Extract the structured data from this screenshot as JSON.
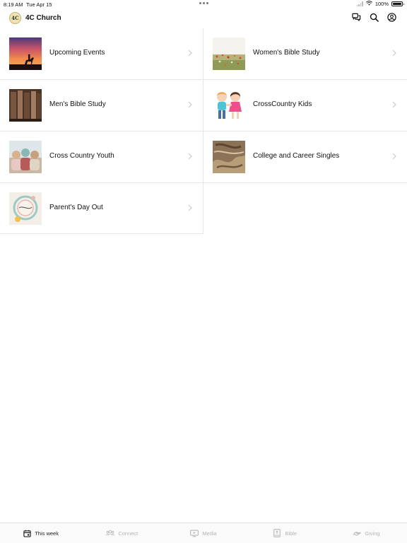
{
  "status_bar": {
    "time": "8:19 AM",
    "date": "Tue Apr 15",
    "battery": "100%"
  },
  "header": {
    "logo_text": "4C",
    "title": "4C Church",
    "icons": [
      "chat-icon",
      "search-icon",
      "account-icon"
    ]
  },
  "items": [
    {
      "label": "Upcoming Events",
      "thumb": "sunset-horse-rider"
    },
    {
      "label": "Women's Bible Study",
      "thumb": "wildflower-field"
    },
    {
      "label": "Men's Bible Study",
      "thumb": "cowboy-boots"
    },
    {
      "label": "CrossCountry Kids",
      "thumb": "cartoon-kids"
    },
    {
      "label": "Cross Country Youth",
      "thumb": "youth-group-hug"
    },
    {
      "label": "College and Career Singles",
      "thumb": "rustic-rope"
    },
    {
      "label": "Parent's Day Out",
      "thumb": "southern-sisters-logo"
    }
  ],
  "tabs": [
    {
      "label": "This week",
      "icon": "calendar-icon",
      "active": true
    },
    {
      "label": "Connect",
      "icon": "people-icon",
      "active": false
    },
    {
      "label": "Media",
      "icon": "tv-icon",
      "active": false
    },
    {
      "label": "Bible",
      "icon": "book-icon",
      "active": false
    },
    {
      "label": "Giving",
      "icon": "giving-hand-icon",
      "active": false
    }
  ],
  "colors": {
    "accent_active": "#222222",
    "tab_inactive": "#b5b5b5",
    "divider": "#e6e6e6"
  }
}
